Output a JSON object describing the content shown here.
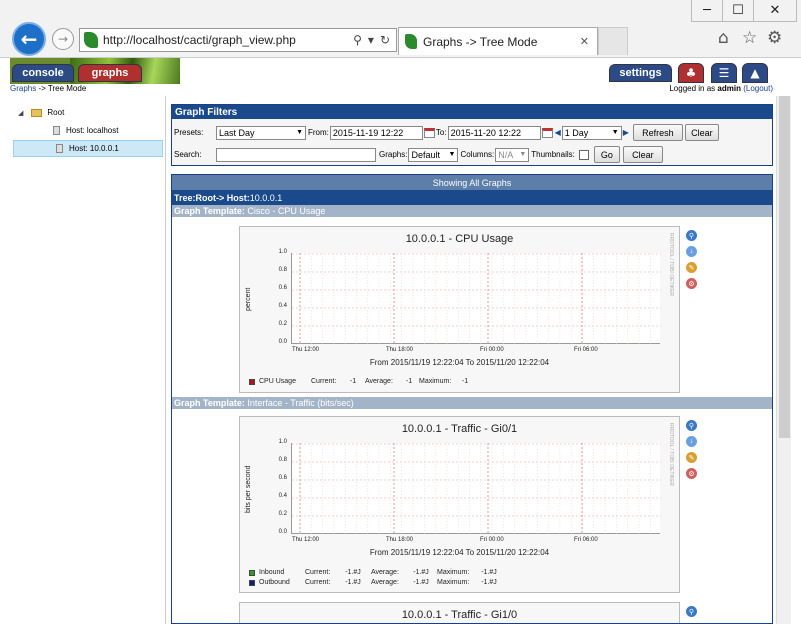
{
  "browser": {
    "url": "http://localhost/cacti/graph_view.php",
    "tab_title": "Graphs -> Tree Mode",
    "window_controls": [
      "─",
      "☐",
      "✕"
    ]
  },
  "header": {
    "tabs": {
      "console": "console",
      "graphs": "graphs",
      "settings": "settings"
    }
  },
  "breadcrumb": {
    "root": "Graphs",
    "sep": "->",
    "current": "Tree Mode"
  },
  "login": {
    "prefix": "Logged in as",
    "user": "admin",
    "logout": "(Logout)"
  },
  "tree": {
    "root": "Root",
    "hosts": [
      "Host: localhost",
      "Host: 10.0.0.1"
    ]
  },
  "filters": {
    "title": "Graph Filters",
    "presets_label": "Presets:",
    "presets_value": "Last Day",
    "from_label": "From:",
    "from_value": "2015-11-19 12:22",
    "to_label": "To:",
    "to_value": "2015-11-20 12:22",
    "span_value": "1 Day",
    "refresh": "Refresh",
    "clear": "Clear",
    "search_label": "Search:",
    "search_value": "",
    "graphs_label": "Graphs:",
    "graphs_value": "Default",
    "columns_label": "Columns:",
    "columns_value": "N/A",
    "thumbnails_label": "Thumbnails:",
    "go": "Go",
    "clear2": "Clear"
  },
  "graphs_area": {
    "showing": "Showing All Graphs",
    "tree_prefix": "Tree:",
    "tree_path": "Root-> Host:",
    "tree_host": "10.0.0.1",
    "template_label": "Graph Template:",
    "templates": [
      "Cisco - CPU Usage",
      "Interface - Traffic (bits/sec)"
    ]
  },
  "graphs": [
    {
      "title": "10.0.0.1 - CPU Usage",
      "ylabel": "percent",
      "yticks": [
        "1.0",
        "0.8",
        "0.6",
        "0.4",
        "0.2",
        "0.0"
      ],
      "xticks": [
        "Thu 12:00",
        "Thu 18:00",
        "Fri 00:00",
        "Fri 06:00"
      ],
      "range": "From 2015/11/19 12:22:04 To 2015/11/20 12:22:04",
      "legend": [
        {
          "name": "CPU Usage",
          "color": "#b01818",
          "current": "Current:",
          "cur_v": "-1",
          "average": "Average:",
          "avg_v": "-1",
          "maximum": "Maximum:",
          "max_v": "-1"
        }
      ]
    },
    {
      "title": "10.0.0.1 - Traffic - Gi0/1",
      "ylabel": "bits per second",
      "yticks": [
        "1.0",
        "0.8",
        "0.6",
        "0.4",
        "0.2",
        "0.0"
      ],
      "xticks": [
        "Thu 12:00",
        "Thu 18:00",
        "Fri 00:00",
        "Fri 06:00"
      ],
      "range": "From 2015/11/19 12:22:04 To 2015/11/20 12:22:04",
      "legend": [
        {
          "name": "Inbound",
          "color": "#2aa02a",
          "current": "Current:",
          "cur_v": "-1.#J",
          "average": "Average:",
          "avg_v": "-1.#J",
          "maximum": "Maximum:",
          "max_v": "-1.#J"
        },
        {
          "name": "Outbound",
          "color": "#10207a",
          "current": "Current:",
          "cur_v": "-1.#J",
          "average": "Average:",
          "avg_v": "-1.#J",
          "maximum": "Maximum:",
          "max_v": "-1.#J"
        }
      ]
    },
    {
      "title": "10.0.0.1 - Traffic - Gi1/0"
    }
  ]
}
